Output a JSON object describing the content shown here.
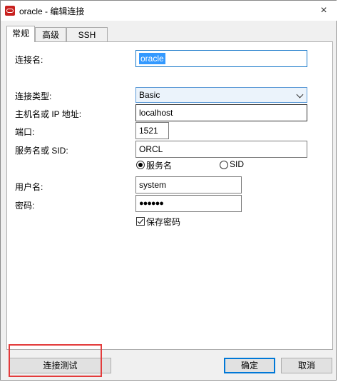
{
  "window": {
    "title": "oracle - 编辑连接",
    "close_glyph": "×"
  },
  "tabs": [
    {
      "label": "常规",
      "active": true
    },
    {
      "label": "高级",
      "active": false
    },
    {
      "label": "SSH",
      "active": false
    }
  ],
  "form": {
    "connection_name_label": "连接名:",
    "connection_name_value": "oracle",
    "connection_type_label": "连接类型:",
    "connection_type_value": "Basic",
    "host_label": "主机名或 IP 地址:",
    "host_value": "localhost",
    "port_label": "端口:",
    "port_value": "1521",
    "service_label": "服务名或 SID:",
    "service_value": "ORCL",
    "radio_service_name_label": "服务名",
    "radio_sid_label": "SID",
    "username_label": "用户名:",
    "username_value": "system",
    "password_label": "密码:",
    "password_value": "●●●●●●",
    "save_password_label": "保存密码"
  },
  "buttons": {
    "test_connection": "连接测试",
    "ok": "确定",
    "cancel": "取消"
  },
  "colors": {
    "accent": "#0078d7",
    "selection": "#3399ff",
    "highlight_annotation": "#e33b3b",
    "app_icon": "#c8211f"
  }
}
